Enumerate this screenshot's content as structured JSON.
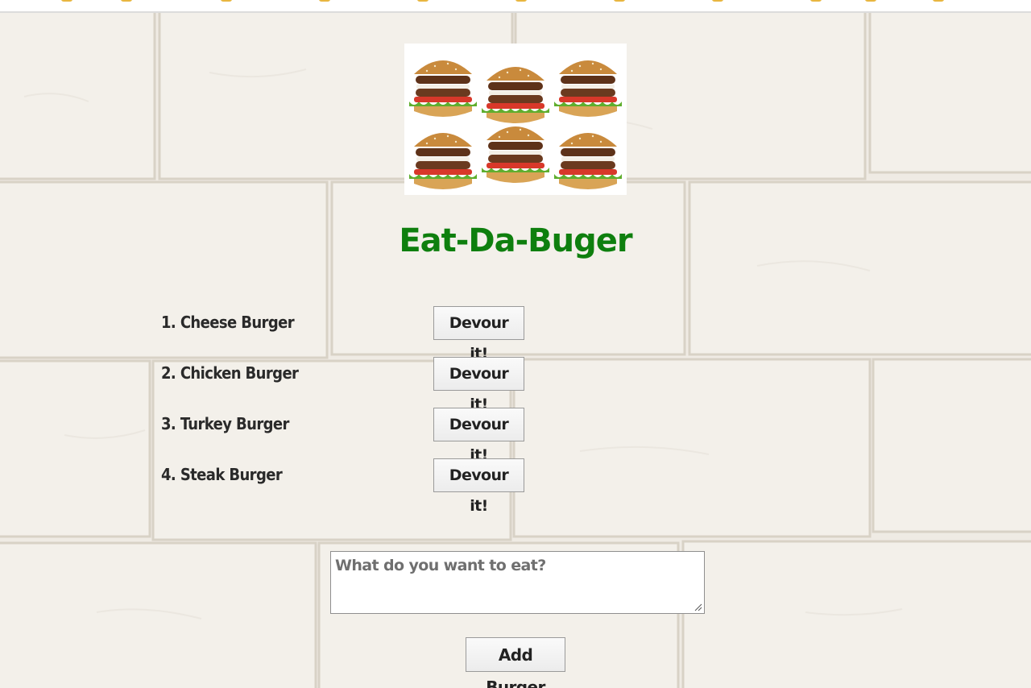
{
  "page": {
    "title": "Eat-Da-Buger"
  },
  "burgers": [
    {
      "label": "1. Cheese Burger",
      "button_label": "Devour it!"
    },
    {
      "label": "2. Chicken Burger",
      "button_label": "Devour it!"
    },
    {
      "label": "3. Turkey Burger",
      "button_label": "Devour it!"
    },
    {
      "label": "4. Steak Burger",
      "button_label": "Devour it!"
    }
  ],
  "form": {
    "placeholder": "What do you want to eat?",
    "value": "",
    "submit_label": "Add Burger"
  },
  "colors": {
    "title": "#0e7f0e",
    "wall": "#efebe4",
    "text": "#2a2a2a"
  },
  "icons": {
    "hero": "burgers-image",
    "grip": "resize-grip-icon"
  }
}
